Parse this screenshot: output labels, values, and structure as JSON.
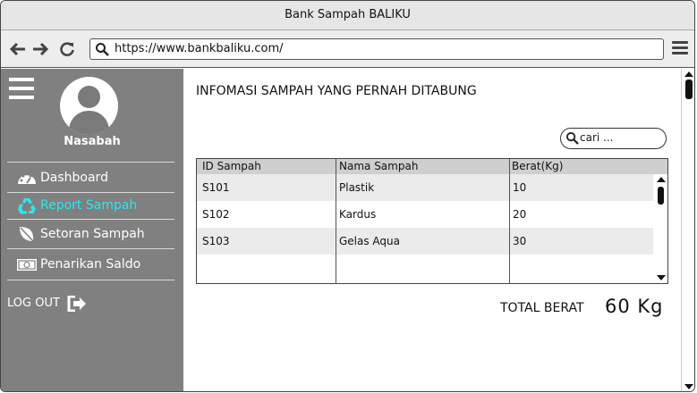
{
  "window": {
    "title": "Bank Sampah BALIKU"
  },
  "browser": {
    "url": "https://www.bankbaliku.com/",
    "back_icon": "arrow-left-icon",
    "forward_icon": "arrow-right-icon",
    "reload_icon": "reload-icon",
    "menu_icon": "hamburger-menu-icon"
  },
  "sidebar": {
    "user_name": "Nasabah",
    "items": [
      {
        "label": "Dashboard",
        "icon": "dashboard-gauge-icon",
        "active": false
      },
      {
        "label": "Report Sampah",
        "icon": "recycle-icon",
        "active": true
      },
      {
        "label": "Setoran Sampah",
        "icon": "leaf-icon",
        "active": false
      },
      {
        "label": "Penarikan Saldo",
        "icon": "banknote-icon",
        "active": false
      }
    ],
    "logout_label": "LOG OUT",
    "active_color": "#29e8ef"
  },
  "main": {
    "title": "INFOMASI SAMPAH YANG PERNAH DITABUNG",
    "search_placeholder": "cari ...",
    "table": {
      "headers": [
        "ID Sampah",
        "Nama Sampah",
        "Berat(Kg)"
      ],
      "rows": [
        [
          "S101",
          "Plastik",
          "10"
        ],
        [
          "S102",
          "Kardus",
          "20"
        ],
        [
          "S103",
          "Gelas Aqua",
          "30"
        ]
      ]
    },
    "total_label": "TOTAL BERAT",
    "total_value": "60 Kg"
  }
}
